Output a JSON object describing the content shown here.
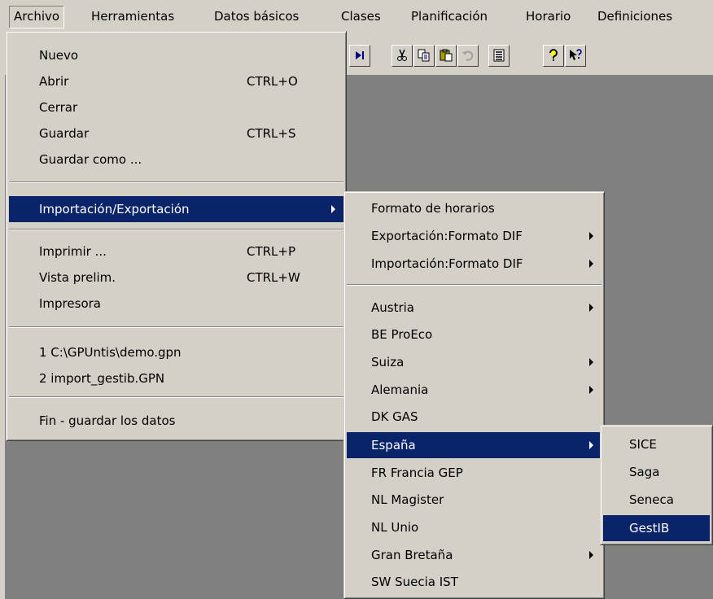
{
  "menubar": {
    "items": [
      "Archivo",
      "Herramientas",
      "Datos básicos",
      "Clases",
      "Planificación",
      "Horario",
      "Definiciones"
    ]
  },
  "toolbar": {
    "buttons": [
      "last-record-icon",
      "cut-icon",
      "copy-icon",
      "paste-icon",
      "undo-icon",
      "list-icon",
      "help-icon",
      "context-help-icon"
    ]
  },
  "file_menu": {
    "new": {
      "label": "Nuevo"
    },
    "open": {
      "label": "Abrir",
      "shortcut": "CTRL+O"
    },
    "close": {
      "label": "Cerrar"
    },
    "save": {
      "label": "Guardar",
      "shortcut": "CTRL+S"
    },
    "save_as": {
      "label": "Guardar como ..."
    },
    "import_export": {
      "label": "Importación/Exportación"
    },
    "print": {
      "label": "Imprimir ...",
      "shortcut": "CTRL+P"
    },
    "preview": {
      "label": "Vista prelim.",
      "shortcut": "CTRL+W"
    },
    "printer": {
      "label": "Impresora"
    },
    "recent_1": {
      "label": "1 C:\\GPUntis\\demo.gpn"
    },
    "recent_2": {
      "label": "2 import_gestib.GPN"
    },
    "exit": {
      "label": "Fin - guardar los datos"
    }
  },
  "import_export_menu": {
    "items": [
      {
        "label": "Formato de horarios",
        "submenu": false
      },
      {
        "label": "Exportación:Formato DIF",
        "submenu": true
      },
      {
        "label": "Importación:Formato DIF",
        "submenu": true
      },
      {
        "label": "Austria",
        "submenu": true
      },
      {
        "label": "BE ProEco",
        "submenu": false
      },
      {
        "label": "Suiza",
        "submenu": true
      },
      {
        "label": "Alemania",
        "submenu": true
      },
      {
        "label": "DK GAS",
        "submenu": false
      },
      {
        "label": "España",
        "submenu": true
      },
      {
        "label": "FR  Francia GEP",
        "submenu": false
      },
      {
        "label": "NL Magister",
        "submenu": false
      },
      {
        "label": "NL Unio",
        "submenu": false
      },
      {
        "label": "Gran Bretaña",
        "submenu": true
      },
      {
        "label": "SW  Suecia IST",
        "submenu": false
      }
    ]
  },
  "spain_menu": {
    "items": [
      "SICE",
      "Saga",
      "Seneca",
      "GestIB"
    ]
  },
  "colors": {
    "face": "#d4d0c8",
    "highlight": "#0a246a",
    "workspace": "#808080"
  }
}
